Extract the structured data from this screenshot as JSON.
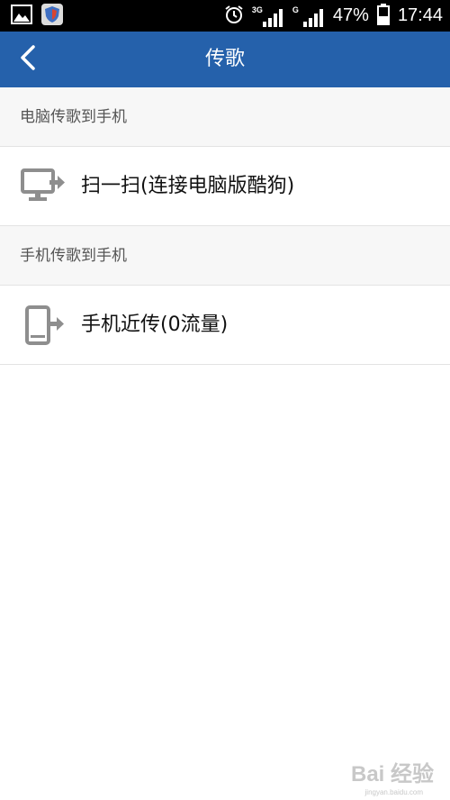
{
  "status_bar": {
    "network_3g": "3G",
    "network_g": "G",
    "battery": "47%",
    "time": "17:44",
    "icons": [
      "gallery-icon",
      "security-app-icon",
      "alarm-icon",
      "signal-icon",
      "signal-icon",
      "battery-icon"
    ],
    "battery_level": 0.47
  },
  "header": {
    "title": "传歌",
    "back_icon": "back-chevron-icon",
    "background": "#2561ab"
  },
  "sections": [
    {
      "title": "电脑传歌到手机",
      "item": {
        "label": "扫一扫(连接电脑版酷狗)",
        "icon": "monitor-transfer-icon"
      }
    },
    {
      "title": "手机传歌到手机",
      "item": {
        "label": "手机近传(0流量)",
        "icon": "phone-transfer-icon"
      }
    }
  ],
  "watermark": {
    "text": "Bai 经验",
    "sub": "jingyan.baidu.com"
  }
}
